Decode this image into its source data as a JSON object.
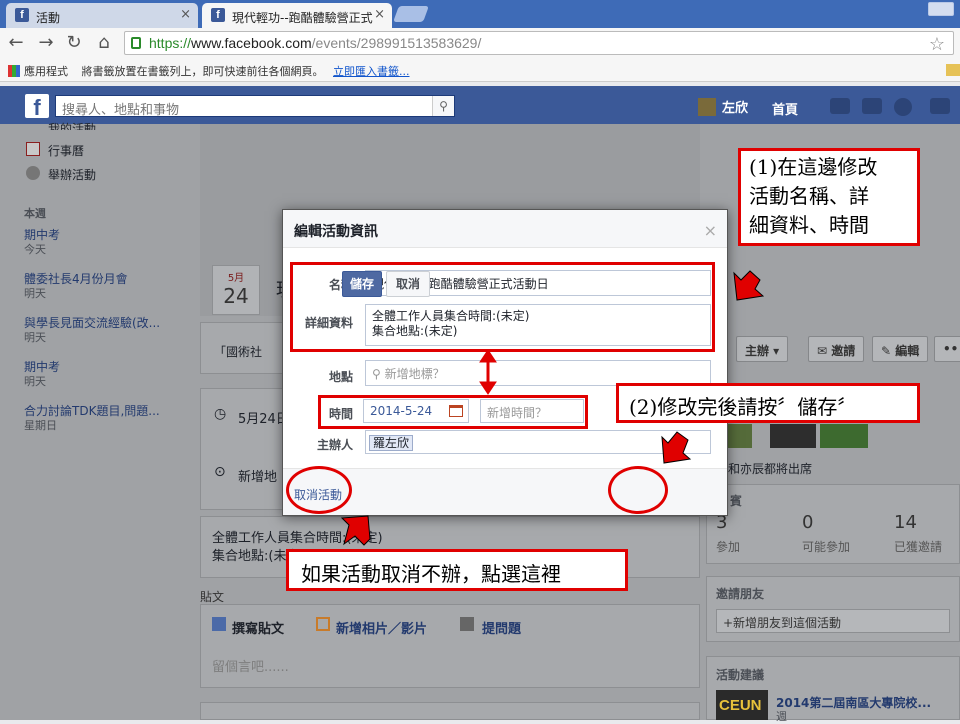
{
  "browser": {
    "tabs": [
      {
        "title": "活動"
      },
      {
        "title": "現代輕功--跑酷體驗營正式"
      }
    ],
    "url": {
      "scheme": "https://",
      "host": "www.facebook.com",
      "path": "/events/298991513583629/"
    },
    "bookmarks_bar": {
      "apps": "應用程式",
      "hint": "將書籤放置在書籤列上，即可快速前往各個網頁。",
      "import_link": "立即匯入書籤..."
    }
  },
  "fb_header": {
    "logo": "f",
    "search_placeholder": "搜尋人、地點和事物",
    "user": "左欣",
    "home": "首頁"
  },
  "left_nav": {
    "cut_item": "我的活動",
    "calendar": "行事曆",
    "create_event": "舉辦活動",
    "section": "本週",
    "events": [
      {
        "name": "期中考",
        "when": "今天"
      },
      {
        "name": "體委社長4月份月會",
        "when": "明天"
      },
      {
        "name": "與學長見面交流經驗(改...",
        "when": "明天"
      },
      {
        "name": "期中考",
        "when": "明天"
      },
      {
        "name": "合力討論TDK題目,問題...",
        "when": "星期日"
      }
    ]
  },
  "event": {
    "date_month": "5月",
    "date_day": "24",
    "title_initial": "現",
    "category_prefix": "「國術社",
    "time_row": "5月24日",
    "place_row": "新增地",
    "details_line1": "全體工作人員集合時間:(未定)",
    "details_line2": "集合地點:(未定)",
    "actions": {
      "host": "主辦 ▾",
      "invite": "邀請",
      "edit": "編輯",
      "more": "•••"
    },
    "going_text": "和亦辰都將出席",
    "guests_title": "賓",
    "stats": [
      {
        "num": "3",
        "label": "參加"
      },
      {
        "num": "0",
        "label": "可能參加"
      },
      {
        "num": "14",
        "label": "已獲邀請"
      }
    ],
    "posts_title": "貼文",
    "composer": {
      "write": "撰寫貼文",
      "photo": "新增相片／影片",
      "question": "提問題",
      "placeholder": "留個言吧......"
    },
    "invite_friends": {
      "title": "邀請朋友",
      "placeholder": "+新增朋友到這個活動"
    },
    "suggestions": {
      "title": "活動建議",
      "item": "2014第二屆南區大專院校...",
      "item_sub": "週",
      "thumb_text": "CEUN"
    }
  },
  "modal": {
    "title": "編輯活動資訊",
    "close": "×",
    "name_label": "名稱",
    "name_value": "現代輕功--跑酷體驗營正式活動日",
    "details_label": "詳細資料",
    "details_line1": "全體工作人員集合時間:(未定)",
    "details_line2": "集合地點:(未定)",
    "location_label": "地點",
    "location_placeholder": "新增地標？",
    "time_label": "時間",
    "date_value": "2014-5-24",
    "time_placeholder": "新增時間？",
    "host_label": "主辦人",
    "host_value": "羅左欣",
    "cancel_event": "取消活動",
    "save": "儲存",
    "cancel": "取消"
  },
  "annotations": {
    "note1_line1": "(1)在這邊修改",
    "note1_line2": "活動名稱、詳",
    "note1_line3": "細資料、時間",
    "note2": "(2)修改完後請按〞儲存〞",
    "note3": "如果活動取消不辦，點選這裡"
  },
  "colors": {
    "fb_blue": "#3b5998",
    "annotation_red": "#e00000"
  }
}
